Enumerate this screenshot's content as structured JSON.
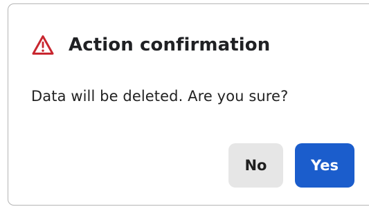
{
  "dialog": {
    "icon": "warning-triangle-icon",
    "title": "Action confirmation",
    "message": "Data will be deleted. Are you sure?",
    "buttons": {
      "no_label": "No",
      "yes_label": "Yes"
    }
  },
  "colors": {
    "warning_icon": "#c8262f",
    "primary_button": "#1b5dcc",
    "secondary_button": "#e6e6e6",
    "border": "#b4b4b4"
  }
}
